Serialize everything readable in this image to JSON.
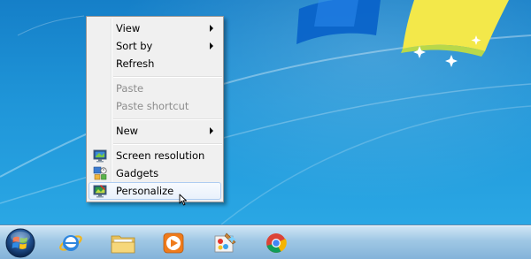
{
  "context_menu": {
    "items": [
      {
        "label": "View",
        "submenu": true,
        "enabled": true
      },
      {
        "label": "Sort by",
        "submenu": true,
        "enabled": true
      },
      {
        "label": "Refresh",
        "submenu": false,
        "enabled": true
      },
      {
        "label": "Paste",
        "submenu": false,
        "enabled": false
      },
      {
        "label": "Paste shortcut",
        "submenu": false,
        "enabled": false
      },
      {
        "label": "New",
        "submenu": true,
        "enabled": true
      },
      {
        "label": "Screen resolution",
        "icon": "screen-resolution-icon",
        "enabled": true
      },
      {
        "label": "Gadgets",
        "icon": "gadgets-icon",
        "enabled": true
      },
      {
        "label": "Personalize",
        "icon": "personalize-icon",
        "enabled": true,
        "highlighted": true
      }
    ]
  },
  "taskbar": {
    "start_icon": "windows-orb-icon",
    "pinned": [
      {
        "icon": "internet-explorer-icon"
      },
      {
        "icon": "file-explorer-icon"
      },
      {
        "icon": "media-player-icon"
      },
      {
        "icon": "paint-icon"
      },
      {
        "icon": "chrome-icon"
      }
    ]
  },
  "colors": {
    "desktop": "#1f8fd0",
    "menu_bg": "#f0f0f0",
    "highlight_border": "#aeccf1"
  }
}
